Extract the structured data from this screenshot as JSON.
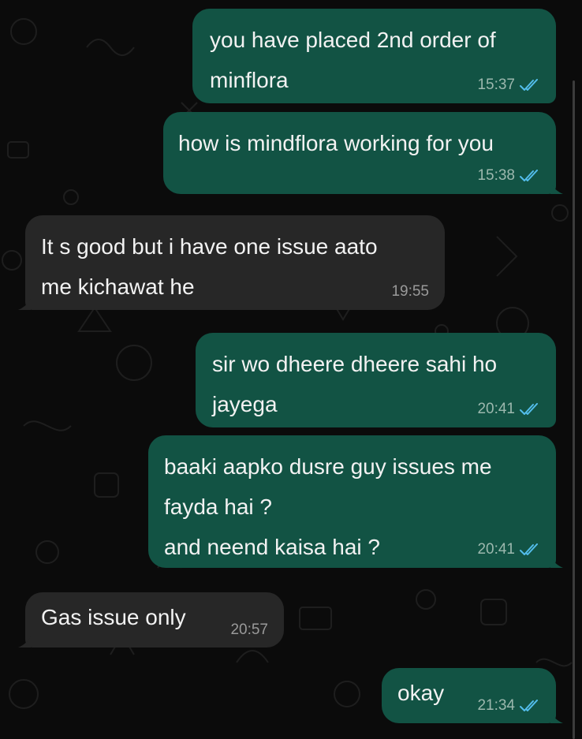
{
  "messages": [
    {
      "direction": "outgoing",
      "text": "you have placed 2nd order of\nminflora",
      "time": "15:37",
      "status": "read"
    },
    {
      "direction": "outgoing",
      "text": "how is mindflora working for you",
      "time": "15:38",
      "status": "read"
    },
    {
      "direction": "incoming",
      "text": "It s good but i have one issue  aato\nme kichawat he",
      "time": "19:55"
    },
    {
      "direction": "outgoing",
      "text": "sir wo dheere dheere sahi ho\njayega",
      "time": "20:41",
      "status": "read"
    },
    {
      "direction": "outgoing",
      "text": "baaki aapko dusre guy issues me\nfayda hai ?\nand neend kaisa hai ?",
      "time": "20:41",
      "status": "read"
    },
    {
      "direction": "incoming",
      "text": "Gas issue only",
      "time": "20:57"
    },
    {
      "direction": "outgoing",
      "text": "okay",
      "time": "21:34",
      "status": "read"
    }
  ],
  "colors": {
    "outgoing_bubble": "#125344",
    "incoming_bubble": "#272727",
    "read_tick": "#53bdeb",
    "background": "#0b0b0b"
  },
  "icons": {
    "read_receipt": "double-check-icon"
  }
}
